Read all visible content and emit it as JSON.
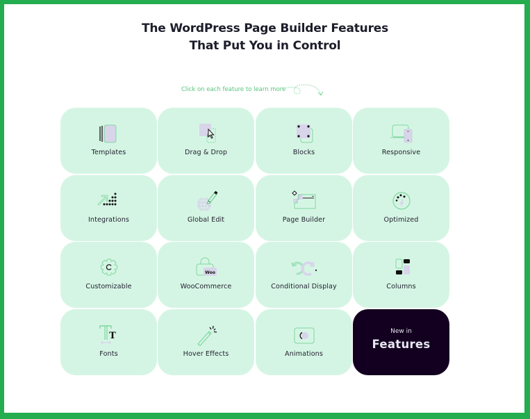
{
  "header": {
    "title_line1": "The WordPress Page Builder Features",
    "title_line2": "That Put You in Control",
    "hint": "Click on each feature to learn more",
    "hint_icon": "dotted-curved-arrow-icon"
  },
  "colors": {
    "border": "#23ad4e",
    "card_bg": "#d5f5e4",
    "accent": "#7fd6a0",
    "lavender": "#d8d4ea",
    "dark_card": "#130020",
    "text": "#222230"
  },
  "features": [
    {
      "label": "Templates",
      "icon": "templates-icon"
    },
    {
      "label": "Drag & Drop",
      "icon": "drag-drop-icon"
    },
    {
      "label": "Blocks",
      "icon": "blocks-icon"
    },
    {
      "label": "Responsive",
      "icon": "responsive-icon"
    },
    {
      "label": "Integrations",
      "icon": "integrations-icon"
    },
    {
      "label": "Global Edit",
      "icon": "global-edit-icon"
    },
    {
      "label": "Page Builder",
      "icon": "page-builder-icon"
    },
    {
      "label": "Optimized",
      "icon": "optimized-icon"
    },
    {
      "label": "Customizable",
      "icon": "gear-icon"
    },
    {
      "label": "WooCommerce",
      "icon": "woocommerce-icon"
    },
    {
      "label": "Conditional Display",
      "icon": "conditional-display-icon"
    },
    {
      "label": "Columns",
      "icon": "columns-icon"
    },
    {
      "label": "Fonts",
      "icon": "fonts-icon"
    },
    {
      "label": "Hover Effects",
      "icon": "magic-wand-icon"
    },
    {
      "label": "Animations",
      "icon": "animations-icon"
    }
  ],
  "new_features_card": {
    "subtitle": "New in",
    "title": "Features"
  }
}
